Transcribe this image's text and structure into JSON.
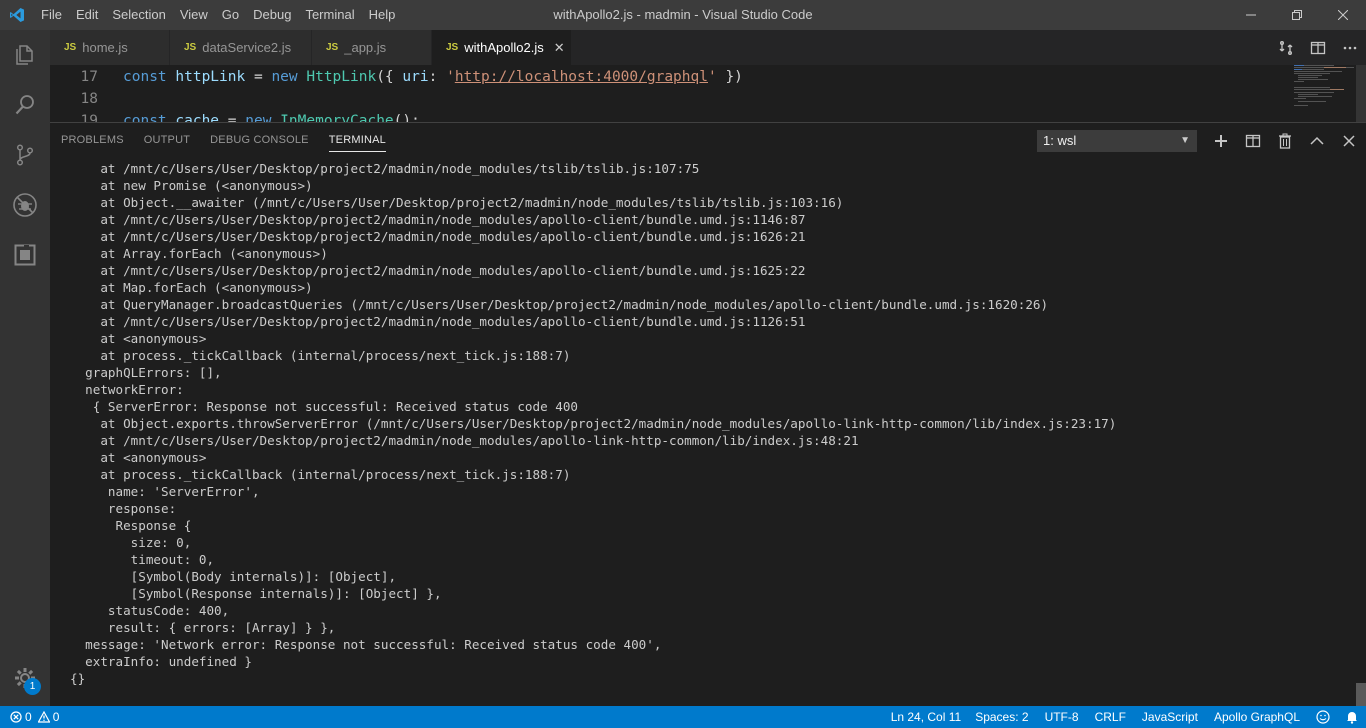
{
  "window": {
    "title": "withApollo2.js - madmin - Visual Studio Code",
    "menu": [
      "File",
      "Edit",
      "Selection",
      "View",
      "Go",
      "Debug",
      "Terminal",
      "Help"
    ]
  },
  "tabs": [
    {
      "badge": "JS",
      "label": "home.js",
      "active": false
    },
    {
      "badge": "JS",
      "label": "dataService2.js",
      "active": false
    },
    {
      "badge": "JS",
      "label": "_app.js",
      "active": false
    },
    {
      "badge": "JS",
      "label": "withApollo2.js",
      "active": true
    }
  ],
  "editor": {
    "lines": [
      {
        "number": "17",
        "tokens": [
          {
            "t": "const ",
            "c": "kw"
          },
          {
            "t": "httpLink",
            "c": "var"
          },
          {
            "t": " = ",
            "c": "plain"
          },
          {
            "t": "new ",
            "c": "kw"
          },
          {
            "t": "HttpLink",
            "c": "fn"
          },
          {
            "t": "({ ",
            "c": "plain"
          },
          {
            "t": "uri",
            "c": "var"
          },
          {
            "t": ": ",
            "c": "plain"
          },
          {
            "t": "'",
            "c": "str"
          },
          {
            "t": "http://localhost:4000/graphql",
            "c": "url"
          },
          {
            "t": "'",
            "c": "str"
          },
          {
            "t": " })",
            "c": "plain"
          }
        ]
      },
      {
        "number": "18",
        "tokens": []
      },
      {
        "number": "19",
        "tokens": [
          {
            "t": "const ",
            "c": "kw"
          },
          {
            "t": "cache",
            "c": "var"
          },
          {
            "t": " = ",
            "c": "plain"
          },
          {
            "t": "new ",
            "c": "kw"
          },
          {
            "t": "InMemoryCache",
            "c": "fn"
          },
          {
            "t": "();",
            "c": "plain"
          }
        ]
      }
    ]
  },
  "panel": {
    "tabs": [
      "PROBLEMS",
      "OUTPUT",
      "DEBUG CONSOLE",
      "TERMINAL"
    ],
    "active_tab": "TERMINAL",
    "terminal_select": "1: wsl",
    "terminal_lines": [
      "    at /mnt/c/Users/User/Desktop/project2/madmin/node_modules/tslib/tslib.js:107:75",
      "    at new Promise (<anonymous>)",
      "    at Object.__awaiter (/mnt/c/Users/User/Desktop/project2/madmin/node_modules/tslib/tslib.js:103:16)",
      "    at /mnt/c/Users/User/Desktop/project2/madmin/node_modules/apollo-client/bundle.umd.js:1146:87",
      "    at /mnt/c/Users/User/Desktop/project2/madmin/node_modules/apollo-client/bundle.umd.js:1626:21",
      "    at Array.forEach (<anonymous>)",
      "    at /mnt/c/Users/User/Desktop/project2/madmin/node_modules/apollo-client/bundle.umd.js:1625:22",
      "    at Map.forEach (<anonymous>)",
      "    at QueryManager.broadcastQueries (/mnt/c/Users/User/Desktop/project2/madmin/node_modules/apollo-client/bundle.umd.js:1620:26)",
      "    at /mnt/c/Users/User/Desktop/project2/madmin/node_modules/apollo-client/bundle.umd.js:1126:51",
      "    at <anonymous>",
      "    at process._tickCallback (internal/process/next_tick.js:188:7)",
      "  graphQLErrors: [],",
      "  networkError:",
      "   { ServerError: Response not successful: Received status code 400",
      "    at Object.exports.throwServerError (/mnt/c/Users/User/Desktop/project2/madmin/node_modules/apollo-link-http-common/lib/index.js:23:17)",
      "    at /mnt/c/Users/User/Desktop/project2/madmin/node_modules/apollo-link-http-common/lib/index.js:48:21",
      "    at <anonymous>",
      "    at process._tickCallback (internal/process/next_tick.js:188:7)",
      "     name: 'ServerError',",
      "     response:",
      "      Response {",
      "        size: 0,",
      "        timeout: 0,",
      "        [Symbol(Body internals)]: [Object],",
      "        [Symbol(Response internals)]: [Object] },",
      "     statusCode: 400,",
      "     result: { errors: [Array] } },",
      "  message: 'Network error: Response not successful: Received status code 400',",
      "  extraInfo: undefined }",
      "{}"
    ]
  },
  "statusbar": {
    "errors": "0",
    "warnings": "0",
    "position": "Ln 24, Col 11",
    "spaces": "Spaces: 2",
    "encoding": "UTF-8",
    "eol": "CRLF",
    "language": "JavaScript",
    "extension": "Apollo GraphQL"
  },
  "activity": {
    "settings_badge": "1"
  },
  "colors": {
    "accent": "#007acc",
    "titlebar": "#3c3c3c",
    "js_badge": "#cbcb41"
  }
}
